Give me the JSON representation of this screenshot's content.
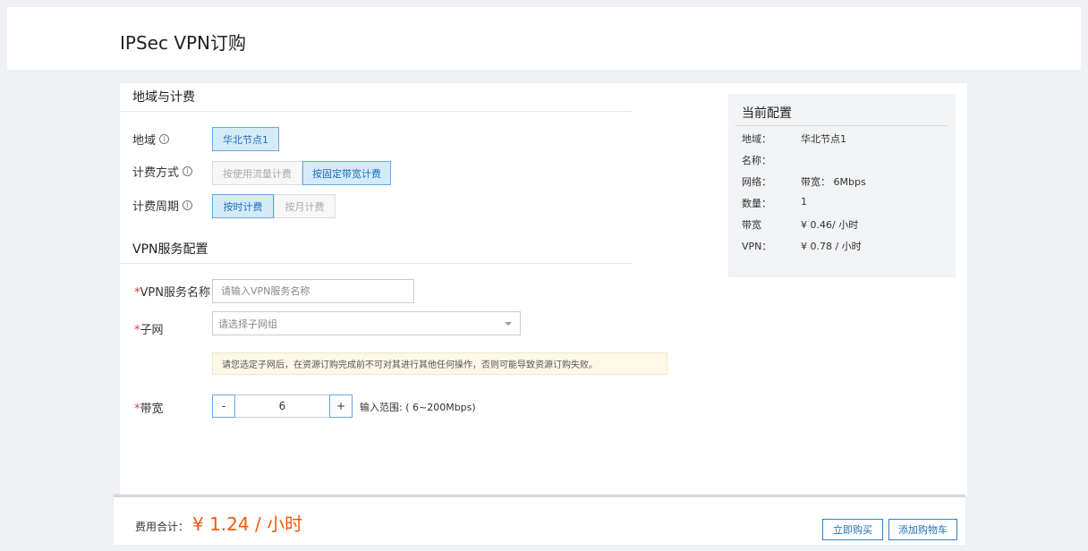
{
  "page": {
    "title": "IPSec VPN订购"
  },
  "region_billing": {
    "section_title": "地域与计费",
    "region": {
      "label": "地域",
      "options": [
        "华北节点1"
      ],
      "selected": "华北节点1"
    },
    "billing_method": {
      "label": "计费方式",
      "options": [
        "按使用流量计费",
        "按固定带宽计费"
      ],
      "selected": "按固定带宽计费"
    },
    "billing_cycle": {
      "label": "计费周期",
      "options": [
        "按时计费",
        "按月计费"
      ],
      "selected": "按时计费"
    }
  },
  "vpn_config": {
    "section_title": "VPN服务配置",
    "name": {
      "required_mark": "*",
      "label": "VPN服务名称",
      "value": "",
      "placeholder": "请输入VPN服务名称"
    },
    "subnet": {
      "required_mark": "*",
      "label": "子网",
      "placeholder": "请选择子网组"
    },
    "notice": "请您选定子网后，在资源订购完成前不可对其进行其他任何操作，否则可能导致资源订购失败。",
    "bandwidth": {
      "required_mark": "*",
      "label": "带宽",
      "minus": "-",
      "plus": "+",
      "value": "6",
      "range_text": "输入范围: ( 6~200Mbps)"
    }
  },
  "current_config": {
    "title": "当前配置",
    "rows": [
      {
        "key": "地域：",
        "value": "华北节点1"
      },
      {
        "key": "名称：",
        "value": ""
      },
      {
        "key": "网络：",
        "value": "带宽： 6Mbps"
      },
      {
        "key": "数量：",
        "value": "1"
      },
      {
        "key": "带宽",
        "value": "¥ 0.46/ 小时"
      },
      {
        "key": "VPN：",
        "value": "¥ 0.78 / 小时"
      }
    ]
  },
  "footer": {
    "total_label": "费用合计：",
    "total_value": "¥ 1.24 / 小时",
    "buy_now": "立即购买",
    "add_to_cart": "添加购物车"
  },
  "colors": {
    "accent": "#2f7dc8",
    "active_bg": "#d6ebfa",
    "price": "#f05a0e",
    "required": "#e4393c",
    "notice_bg": "#fdf8e7"
  }
}
